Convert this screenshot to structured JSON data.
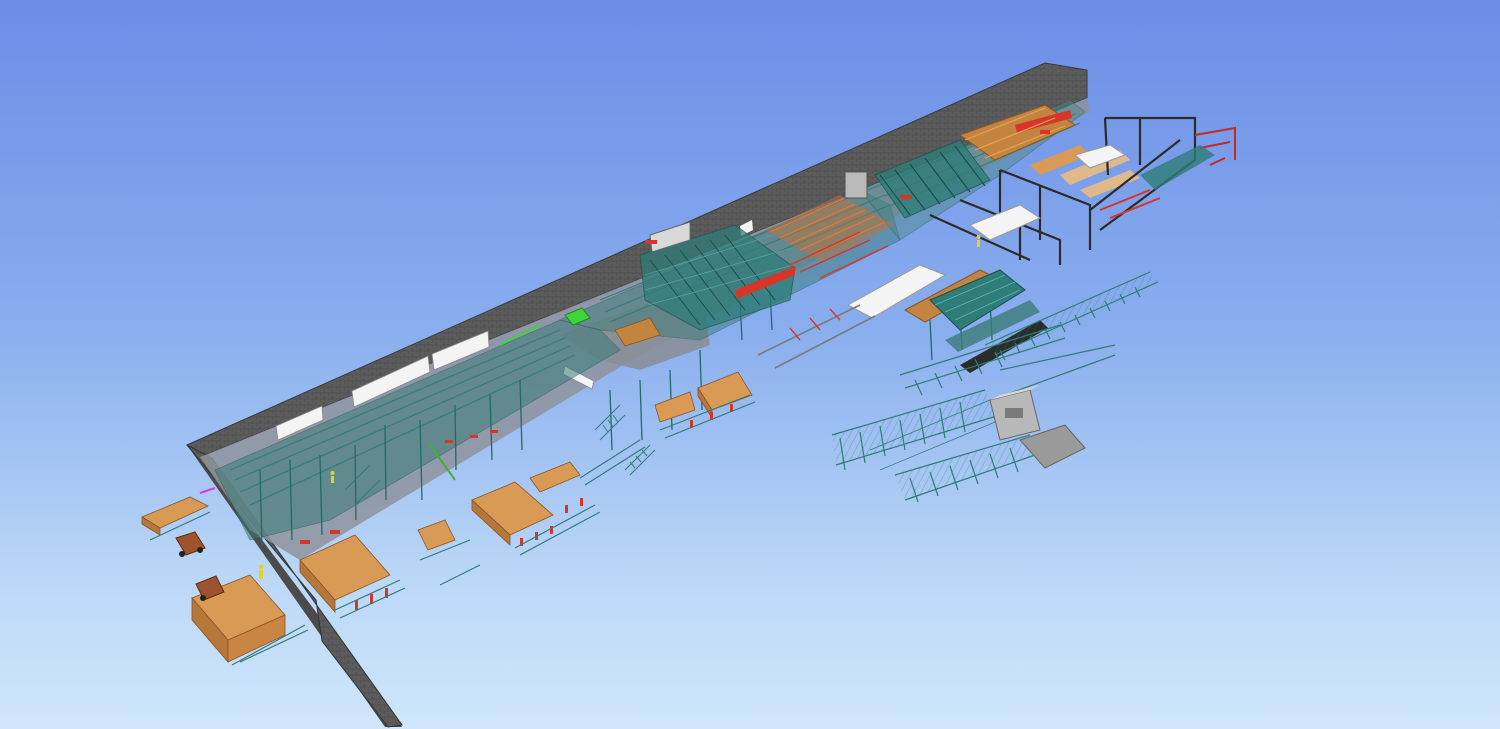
{
  "scene": {
    "colors": {
      "sky_top": "#6b8de6",
      "sky_bottom": "#cfe6fb",
      "wall": "#5e5e5e",
      "wall_dark": "#3f3f3f",
      "floor": "#9a9ea6",
      "frame": "#2f7d78",
      "frame_dark": "#1f5753",
      "timber": "#d89a55",
      "timber_dark": "#b5773a",
      "accent_red": "#d8352a",
      "accent_green": "#3fd43a",
      "white_panel": "#f4f4f4",
      "press_gray": "#8d8d8d",
      "bridge_dark": "#2b2b2b"
    }
  }
}
